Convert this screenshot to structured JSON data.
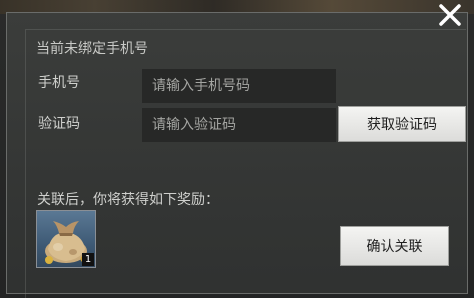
{
  "dialog": {
    "status_text": "当前未绑定手机号",
    "phone_label": "手机号",
    "phone_placeholder": "请输入手机号码",
    "code_label": "验证码",
    "code_placeholder": "请输入验证码",
    "get_code_button": "获取验证码",
    "reward_text": "关联后，你将获得如下奖励：",
    "reward_item": {
      "icon": "money-bag-icon",
      "count": "1"
    },
    "confirm_button": "确认关联",
    "close_icon": "close-icon"
  },
  "colors": {
    "panel_bg": "#353736",
    "text": "#cfd0cd",
    "input_bg": "#272827",
    "button_bg": "#e8e8e6",
    "reward_bg": "#4a6784"
  }
}
